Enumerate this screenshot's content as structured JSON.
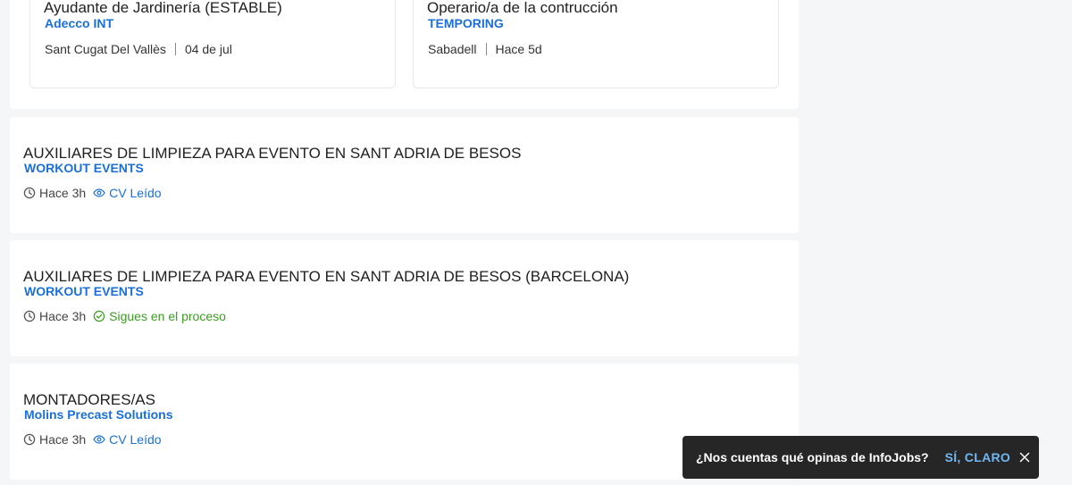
{
  "recommended": [
    {
      "title": "Ayudante de Jardinería (ESTABLE)",
      "company": "Adecco INT",
      "location": "Sant Cugat Del Vallès",
      "date": "04 de jul"
    },
    {
      "title": "Operario/a de la contrucción",
      "company": "TEMPORING",
      "location": "Sabadell",
      "date": "Hace 5d"
    }
  ],
  "jobs": [
    {
      "title": "AUXILIARES DE LIMPIEZA PARA EVENTO EN SANT ADRIA DE BESOS",
      "company": "WORKOUT EVENTS",
      "time": "Hace 3h",
      "status": "CV Leído",
      "status_icon": "eye-icon"
    },
    {
      "title": "AUXILIARES DE LIMPIEZA PARA EVENTO EN SANT ADRIA DE BESOS (BARCELONA)",
      "company": "WORKOUT EVENTS",
      "time": "Hace 3h",
      "status": "Sigues en el proceso",
      "status_icon": "check-circle-icon"
    },
    {
      "title": "MONTADORES/AS",
      "company": "Molins Precast Solutions",
      "time": "Hace 3h",
      "status": "CV Leído",
      "status_icon": "eye-icon"
    }
  ],
  "toast": {
    "text": "¿Nos cuentas qué opinas de InfoJobs?",
    "action": "SÍ, CLARO"
  },
  "colors": {
    "company_link": "#1a6fd8",
    "status_read": "#1a6fd8",
    "status_process": "#3c9b23",
    "toast_bg": "#262626",
    "toast_action": "#6fb7f2"
  }
}
